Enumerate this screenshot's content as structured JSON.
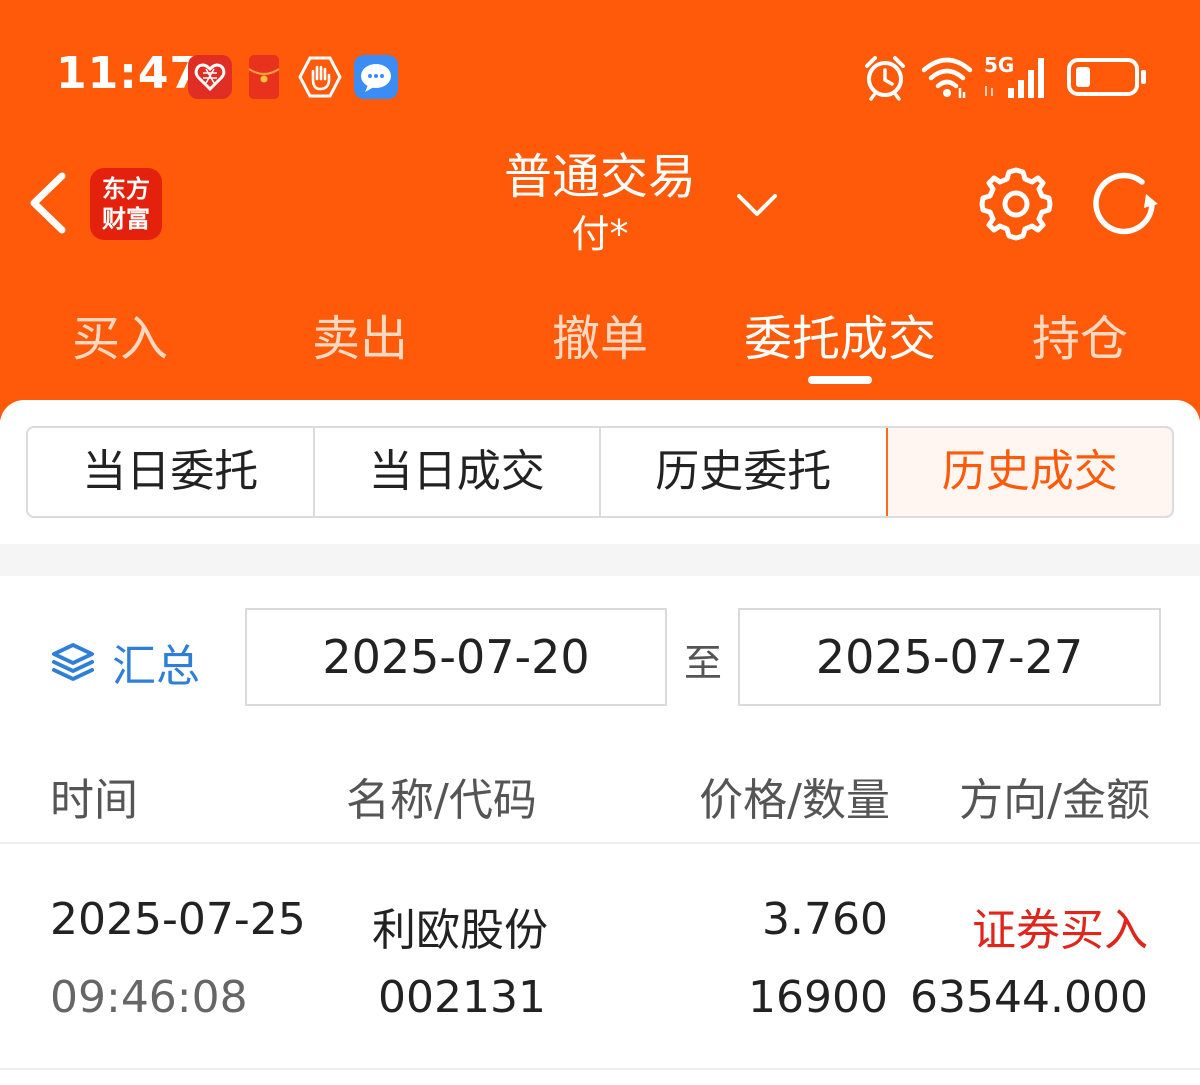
{
  "status_bar": {
    "time": "11:47",
    "network": "5G",
    "icons": [
      "pinduoduo-app-icon",
      "red-envelope-icon",
      "hand-stop-icon",
      "message-app-icon",
      "alarm-icon",
      "wifi-icon",
      "signal-icon",
      "battery-icon"
    ]
  },
  "nav": {
    "logo_line1": "东方",
    "logo_line2": "财富",
    "title": "普通交易",
    "subtitle": "付*",
    "icons": [
      "back-arrow-icon",
      "chevron-down-icon",
      "gear-icon",
      "refresh-icon"
    ]
  },
  "tabs": [
    {
      "label": "买入",
      "active": false
    },
    {
      "label": "卖出",
      "active": false
    },
    {
      "label": "撤单",
      "active": false
    },
    {
      "label": "委托成交",
      "active": true
    },
    {
      "label": "持仓",
      "active": false
    }
  ],
  "segments": [
    {
      "label": "当日委托",
      "active": false
    },
    {
      "label": "当日成交",
      "active": false
    },
    {
      "label": "历史委托",
      "active": false
    },
    {
      "label": "历史成交",
      "active": true
    }
  ],
  "filter": {
    "summary_label": "汇总",
    "start_date": "2025-07-20",
    "separator": "至",
    "end_date": "2025-07-27"
  },
  "table": {
    "headers": [
      "时间",
      "名称/代码",
      "价格/数量",
      "方向/金额"
    ],
    "rows": [
      {
        "date": "2025-07-25",
        "time": "09:46:08",
        "name": "利欧股份",
        "code": "002131",
        "price": "3.760",
        "quantity": "16900",
        "direction": "证券买入",
        "amount": "63544.000"
      }
    ]
  },
  "colors": {
    "brand_orange": "#ff5a0a",
    "summary_blue": "#2f7fd8",
    "buy_red": "#e0251c"
  }
}
